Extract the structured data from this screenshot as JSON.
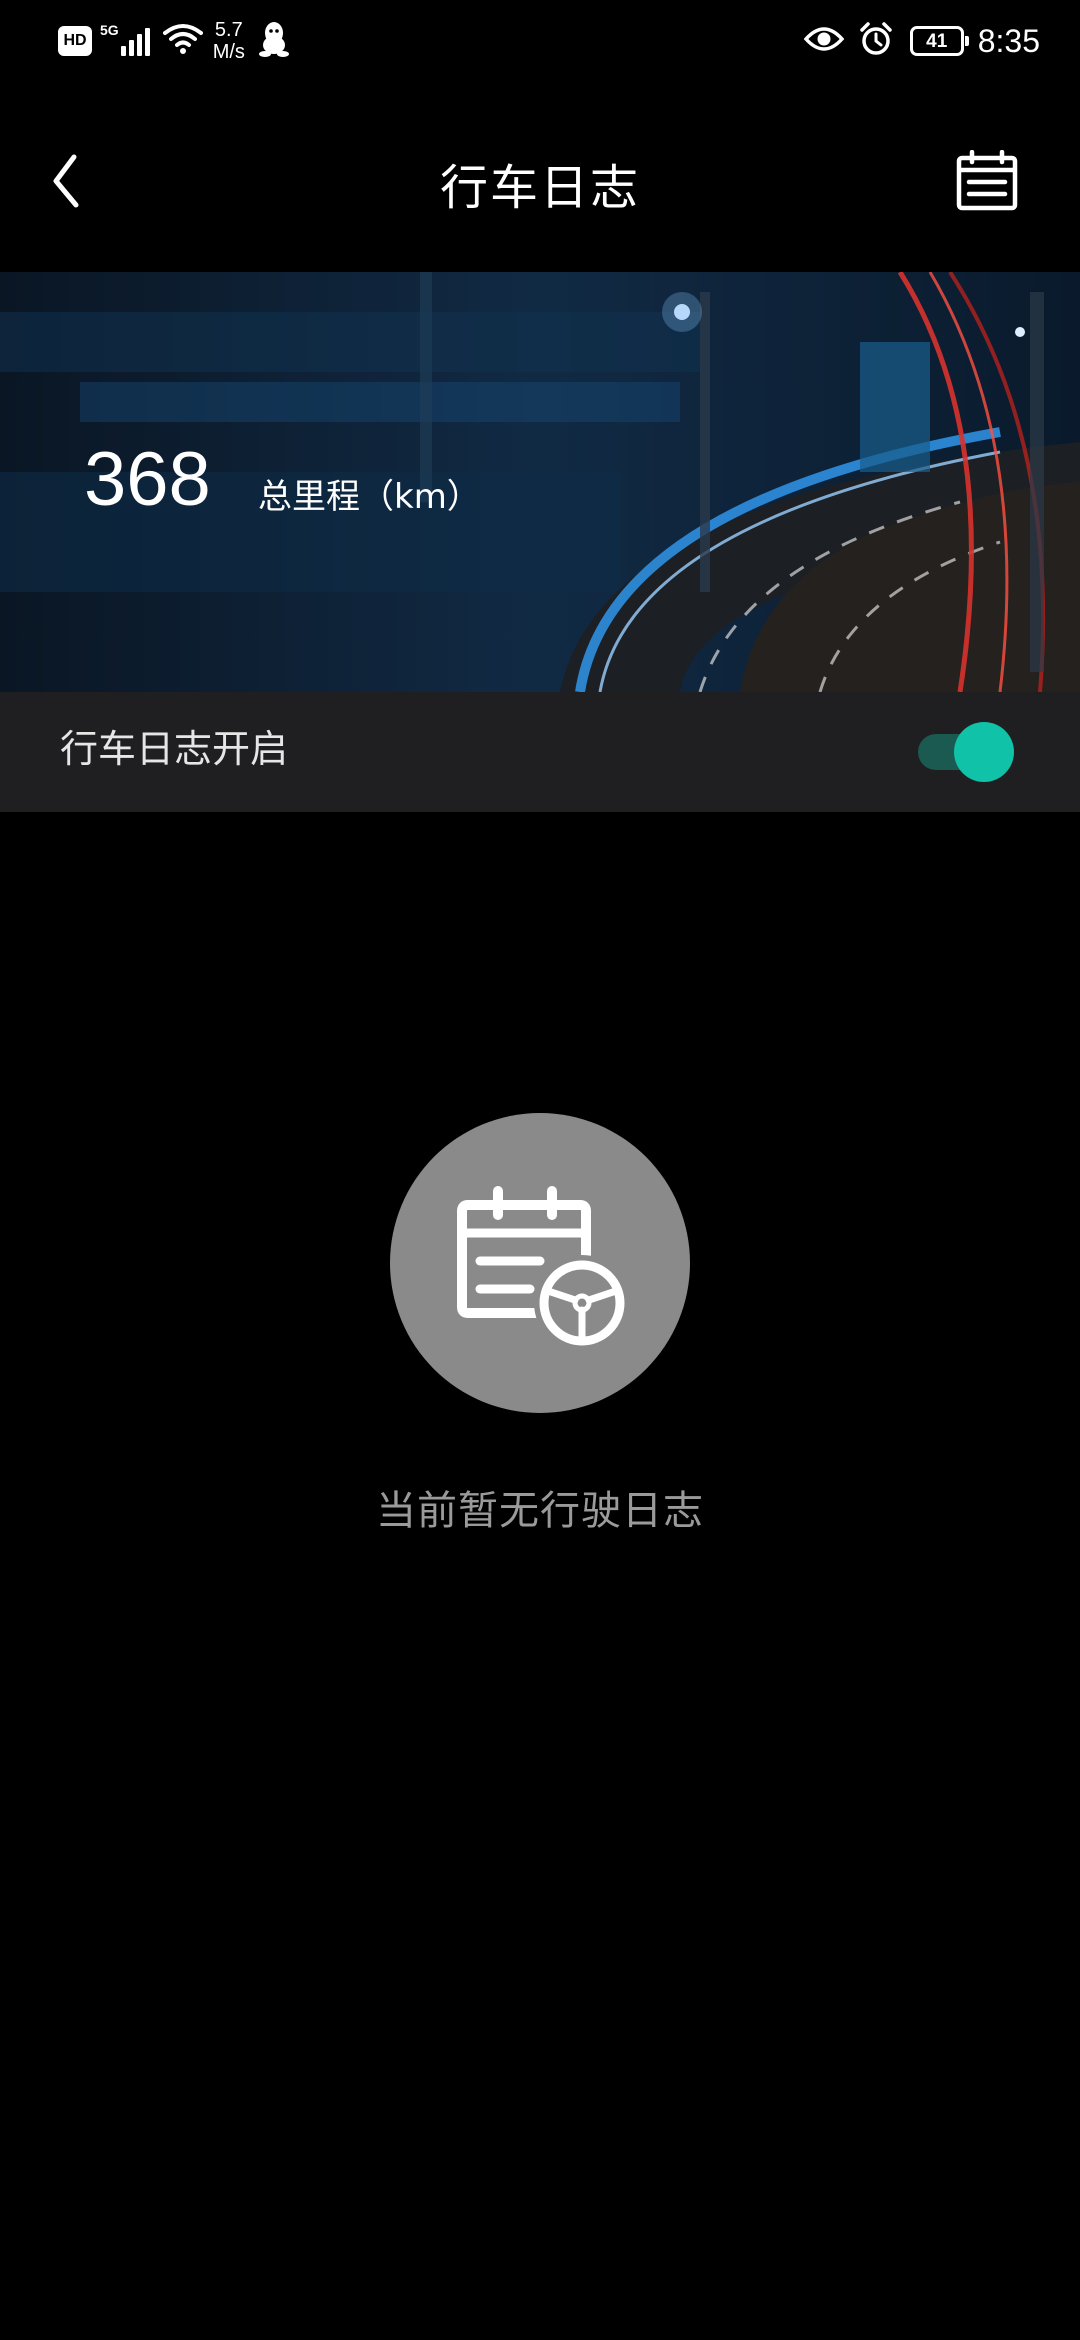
{
  "status_bar": {
    "hd": "HD",
    "network": "5G",
    "speed_value": "5.7",
    "speed_unit": "M/s",
    "battery": "41",
    "time": "8:35"
  },
  "app_bar": {
    "title": "行车日志"
  },
  "banner": {
    "mileage_value": "368",
    "mileage_label": "总里程（km）"
  },
  "log_toggle": {
    "label": "行车日志开启",
    "enabled": true,
    "accent_color": "#0fc2a8"
  },
  "empty_state": {
    "message": "当前暂无行驶日志",
    "icon": "calendar-steering-wheel-icon"
  }
}
